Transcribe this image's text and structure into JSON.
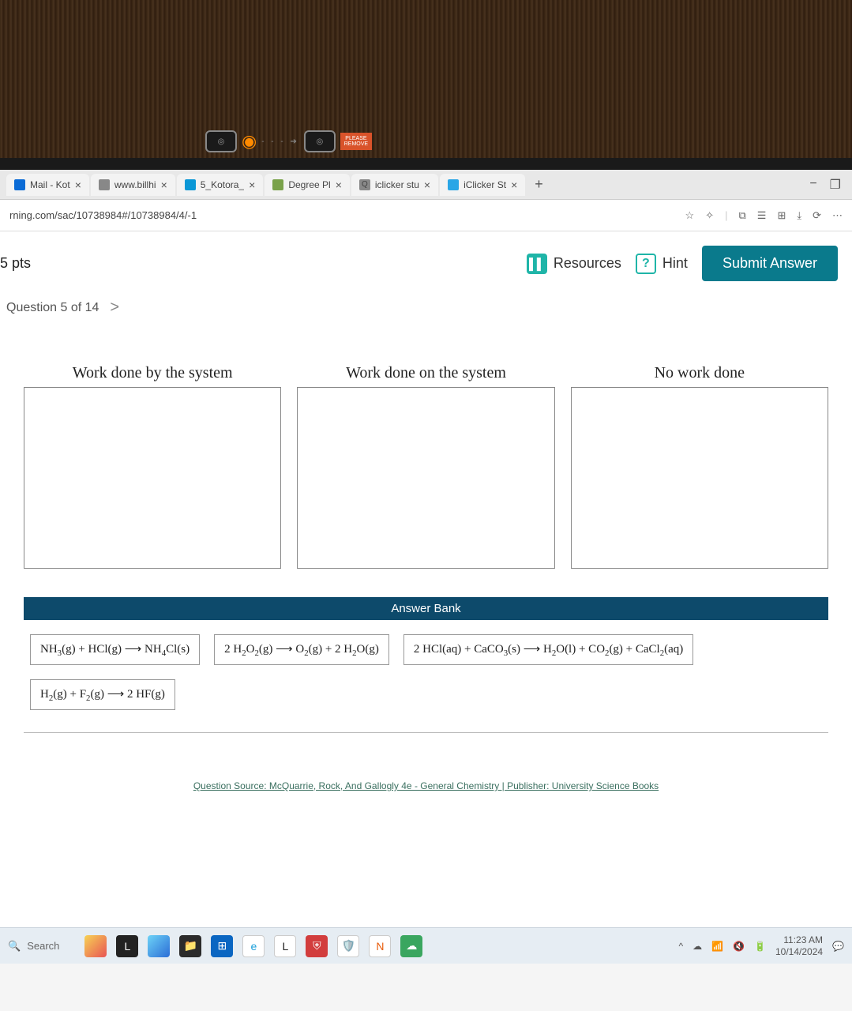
{
  "tabs": [
    {
      "label": "Mail - Kot",
      "color": "#0a6bd6"
    },
    {
      "label": "www.billhi",
      "color": "#888"
    },
    {
      "label": "5_Kotora_",
      "color": "#0a97d6"
    },
    {
      "label": "Degree Pl",
      "color": "#7aa24a"
    },
    {
      "label": "iclicker stu",
      "color": "#888"
    },
    {
      "label": "iClicker St",
      "color": "#2aa6e6"
    }
  ],
  "newtab_label": "+",
  "win": {
    "min": "−",
    "restore": "❐",
    "close": "×"
  },
  "url": "rning.com/sac/10738984#/10738984/4/-1",
  "addr_icons": {
    "star": "☆",
    "ext": "✧",
    "split": "⧉",
    "read": "☰",
    "coll": "⊞",
    "down": "⤓",
    "sync": "⟳",
    "more": "⋯"
  },
  "points_label": "5 pts",
  "resources_label": "Resources",
  "hint_label": "Hint",
  "hint_glyph": "?",
  "submit_label": "Submit Answer",
  "question_label": "Question 5 of 14",
  "chev": ">",
  "overlay_text": "PLEASE REMOVE",
  "drop_titles": {
    "by": "Work done by the system",
    "on": "Work done on the system",
    "none": "No work done"
  },
  "answer_bank_header": "Answer Bank",
  "reactions": {
    "r1_html": "NH<sub>3</sub>(g) + HCl(g) ⟶ NH<sub>4</sub>Cl(s)",
    "r2_html": "2 H<sub>2</sub>O<sub>2</sub>(g) ⟶ O<sub>2</sub>(g) + 2 H<sub>2</sub>O(g)",
    "r3_html": "2 HCl(aq) + CaCO<sub>3</sub>(s) ⟶ H<sub>2</sub>O(l) + CO<sub>2</sub>(g) + CaCl<sub>2</sub>(aq)",
    "r4_html": "H<sub>2</sub>(g) + F<sub>2</sub>(g) ⟶ 2 HF(g)"
  },
  "question_source": "Question Source: McQuarrie, Rock, And Gallogly 4e - General Chemistry  |  Publisher: University Science Books",
  "taskbar": {
    "search": "Search",
    "time": "11:23 AM",
    "date": "10/14/2024"
  }
}
